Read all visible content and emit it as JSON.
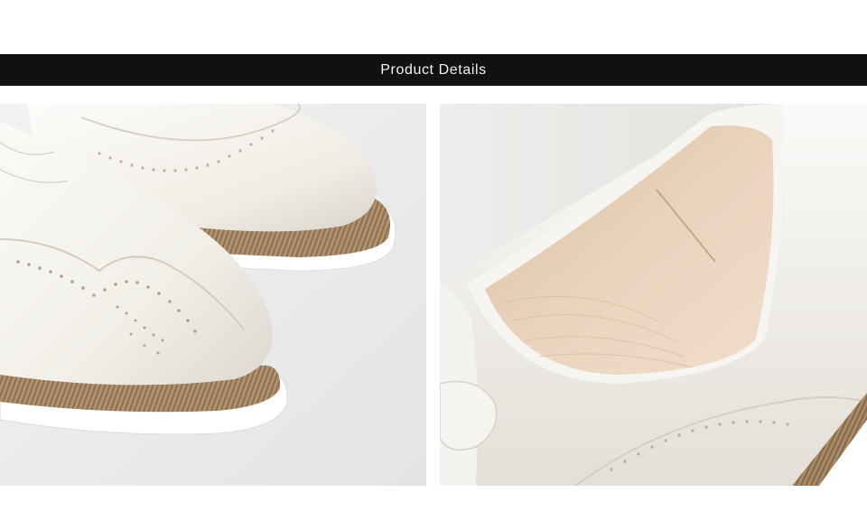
{
  "header": {
    "title": "Product Details",
    "background": "#111111",
    "text_color": "#f2f2f2"
  },
  "photos": [
    {
      "subject": "white-brogue-toe-closeup"
    },
    {
      "subject": "white-brogue-heel-lining-closeup"
    }
  ],
  "colors": {
    "leather": "#f5f3ee",
    "welt": "#a88a66",
    "sole": "#ffffff",
    "lining": "#e6cdb2"
  }
}
